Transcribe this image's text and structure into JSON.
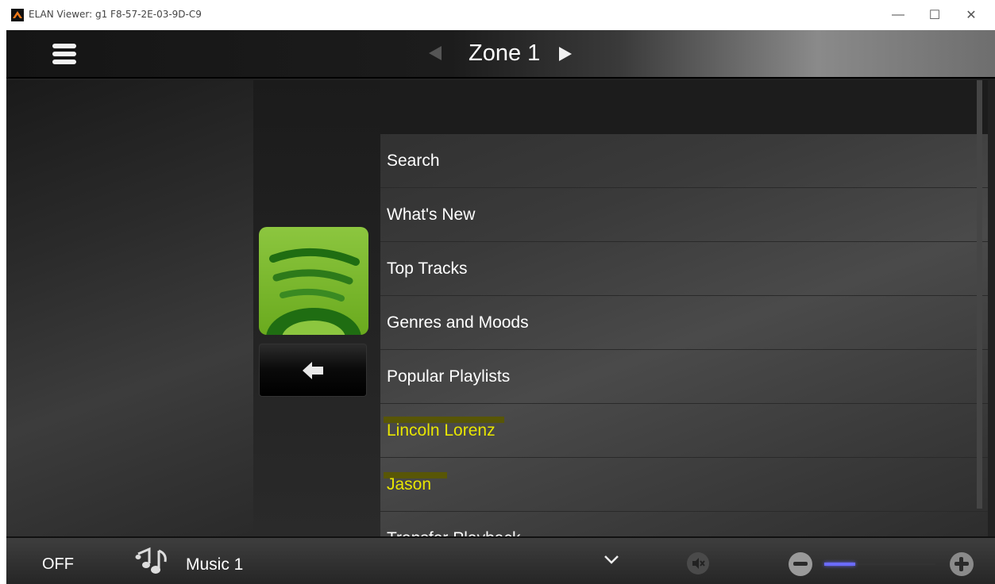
{
  "window": {
    "title": "ELAN Viewer: g1 F8-57-2E-03-9D-C9",
    "minimize_label": "—",
    "maximize_label": "☐",
    "close_label": "✕"
  },
  "header": {
    "zone_title": "Zone 1",
    "menu_icon": "hamburger-icon",
    "prev_icon": "triangle-left-icon",
    "next_icon": "triangle-right-icon"
  },
  "source_panel": {
    "logo_icon": "spotify-icon",
    "back_icon": "back-arrow-icon"
  },
  "menu_list": {
    "items": [
      {
        "label": "Search",
        "highlight": false
      },
      {
        "label": "What's New",
        "highlight": false
      },
      {
        "label": "Top Tracks",
        "highlight": false
      },
      {
        "label": "Genres and Moods",
        "highlight": false
      },
      {
        "label": "Popular Playlists",
        "highlight": false
      },
      {
        "label": "Lincoln Lorenz",
        "highlight": true
      },
      {
        "label": "Jason",
        "highlight": true
      },
      {
        "label": "Transfer Playback",
        "highlight": false
      }
    ]
  },
  "footer": {
    "power_label": "OFF",
    "source_label": "Music 1",
    "source_icon": "music-notes-icon",
    "dropdown_icon": "chevron-down-icon",
    "mute_icon": "mute-icon",
    "volume_down_icon": "minus-circle-icon",
    "volume_up_icon": "plus-circle-icon",
    "volume_level": 0.28
  },
  "colors": {
    "highlight_text": "#e8e600",
    "volume_accent": "#6b6bff",
    "spotify_green": "#8cc63f"
  }
}
